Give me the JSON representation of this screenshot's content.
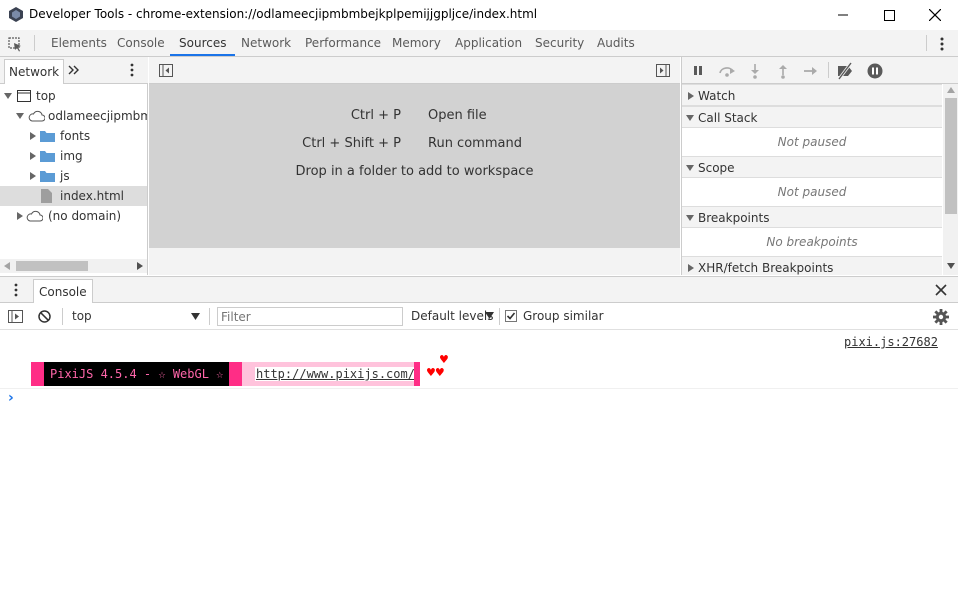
{
  "window": {
    "title": "Developer Tools - chrome-extension://odlameecjipmbmbejkplpemijjgpljce/index.html"
  },
  "main_tabs": [
    {
      "label": "Elements"
    },
    {
      "label": "Console"
    },
    {
      "label": "Sources",
      "active": true
    },
    {
      "label": "Network"
    },
    {
      "label": "Performance"
    },
    {
      "label": "Memory"
    },
    {
      "label": "Application"
    },
    {
      "label": "Security"
    },
    {
      "label": "Audits"
    }
  ],
  "navigator": {
    "tab_label": "Network",
    "tree": {
      "top": "top",
      "origin": "odlameecjipmbmbejkplpemijjgpljce",
      "folders": [
        "fonts",
        "img",
        "js"
      ],
      "file": "index.html",
      "no_domain": "(no domain)"
    }
  },
  "editor": {
    "shortcuts": [
      {
        "keys": "Ctrl + P",
        "action": "Open file"
      },
      {
        "keys": "Ctrl + Shift + P",
        "action": "Run command"
      }
    ],
    "drop_hint": "Drop in a folder to add to workspace"
  },
  "debugger": {
    "panes": [
      {
        "title": "Watch",
        "expanded": false,
        "body": ""
      },
      {
        "title": "Call Stack",
        "expanded": true,
        "body": "Not paused"
      },
      {
        "title": "Scope",
        "expanded": true,
        "body": "Not paused"
      },
      {
        "title": "Breakpoints",
        "expanded": true,
        "body": "No breakpoints"
      },
      {
        "title": "XHR/fetch Breakpoints",
        "expanded": false,
        "body": ""
      }
    ]
  },
  "drawer": {
    "tab_label": "Console"
  },
  "console": {
    "context": "top",
    "filter_placeholder": "Filter",
    "levels_label": "Default levels",
    "group_similar_label": "Group similar",
    "group_similar_checked": true,
    "log_source": "pixi.js:27682",
    "pixi_banner": "PixiJS 4.5.4 - ☆ WebGL ☆",
    "pixi_url": "http://www.pixijs.com/",
    "hearts_top": "♥",
    "hearts_bottom": "♥♥",
    "prompt": "›"
  },
  "colors": {
    "accent": "#1a73e8",
    "pixi_black": "#000000",
    "pixi_pink": "#ff2d86",
    "pixi_light_pink": "#ffc3dc",
    "heart_red": "#ff0000"
  }
}
